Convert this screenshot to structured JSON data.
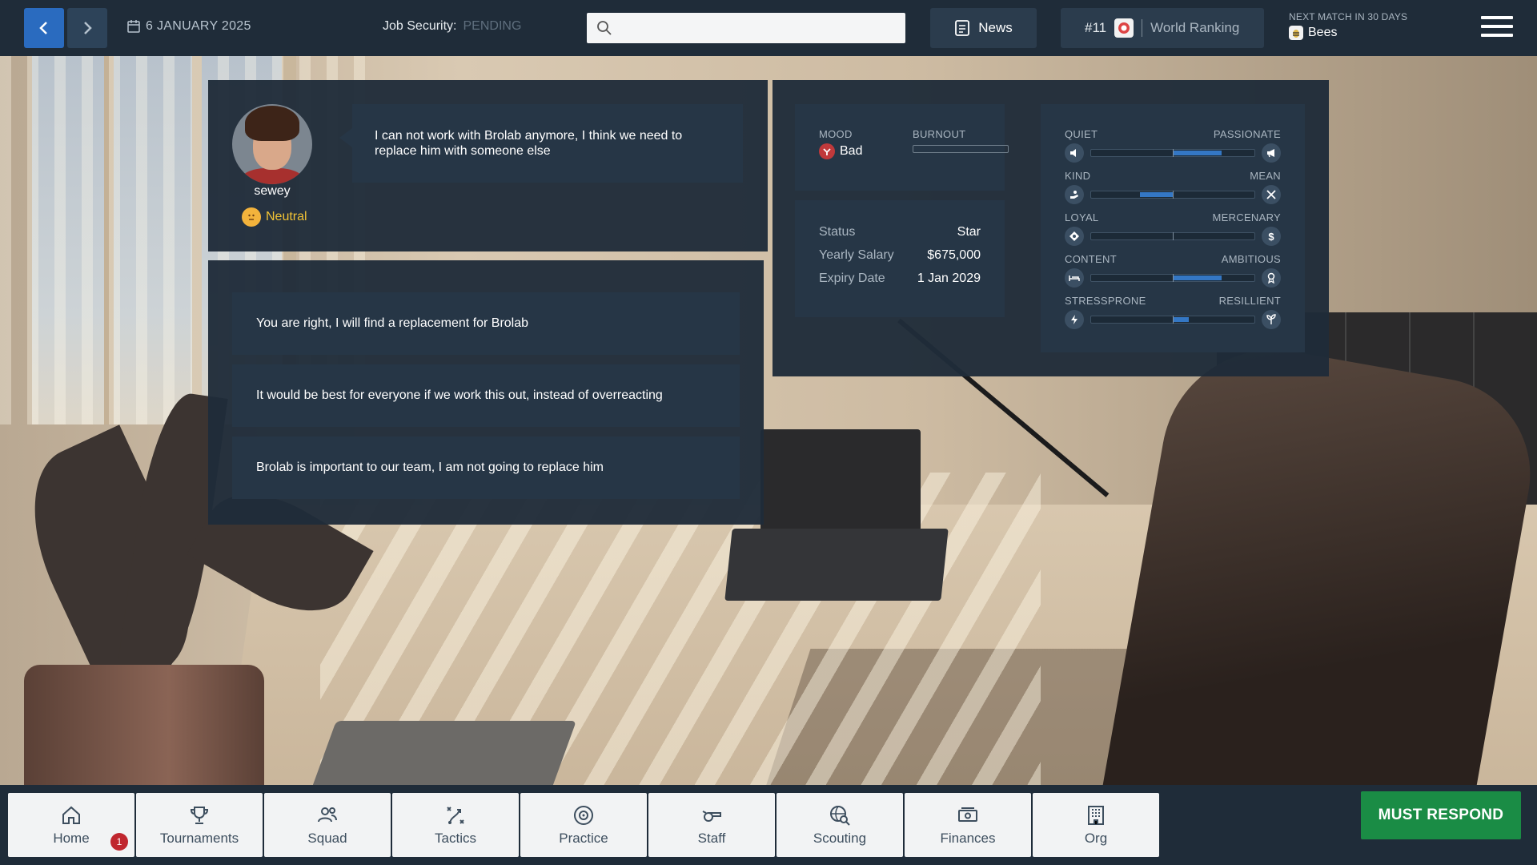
{
  "topbar": {
    "date": "6 JANUARY 2025",
    "job_security_label": "Job Security:",
    "job_security_value": "PENDING",
    "search_placeholder": "",
    "news_label": "News",
    "rank": "#11",
    "rank_label": "World Ranking",
    "next_match_label": "NEXT MATCH IN 30 DAYS",
    "next_match_team": "Bees"
  },
  "dialog": {
    "player_name": "sewey",
    "player_mood": "Neutral",
    "message": "I can not work with Brolab anymore, I think we need to replace him with someone else"
  },
  "answers": [
    "You are right, I will find a replacement for Brolab",
    "It would be best for everyone if we work this out, instead of overreacting",
    "Brolab is important to our team, I am not going to replace him"
  ],
  "stats": {
    "mood_label": "MOOD",
    "mood_value": "Bad",
    "burnout_label": "BURNOUT",
    "contract": [
      {
        "key": "Status",
        "value": "Star"
      },
      {
        "key": "Yearly Salary",
        "value": "$675,000"
      },
      {
        "key": "Expiry Date",
        "value": "1 Jan 2029"
      }
    ],
    "traits": [
      {
        "left": "QUIET",
        "right": "PASSIONATE",
        "from": 0.5,
        "to": 0.8,
        "left_icon": "speaker-mute-icon",
        "right_icon": "megaphone-icon"
      },
      {
        "left": "KIND",
        "right": "MEAN",
        "from": 0.3,
        "to": 0.5,
        "left_icon": "helping-hand-icon",
        "right_icon": "crossed-swords-icon"
      },
      {
        "left": "LOYAL",
        "right": "MERCENARY",
        "from": 0.5,
        "to": 0.5,
        "left_icon": "shield-heart-icon",
        "right_icon": "dollar-icon"
      },
      {
        "left": "CONTENT",
        "right": "AMBITIOUS",
        "from": 0.5,
        "to": 0.8,
        "left_icon": "bed-icon",
        "right_icon": "medal-icon"
      },
      {
        "left": "STRESSPRONE",
        "right": "RESILLIENT",
        "from": 0.5,
        "to": 0.6,
        "left_icon": "lightning-icon",
        "right_icon": "sprout-icon"
      }
    ]
  },
  "bottom_nav": [
    {
      "label": "Home",
      "icon": "home-icon"
    },
    {
      "label": "Tournaments",
      "icon": "trophy-icon"
    },
    {
      "label": "Squad",
      "icon": "users-icon"
    },
    {
      "label": "Tactics",
      "icon": "tactics-icon"
    },
    {
      "label": "Practice",
      "icon": "target-icon"
    },
    {
      "label": "Staff",
      "icon": "whistle-icon"
    },
    {
      "label": "Scouting",
      "icon": "globe-search-icon"
    },
    {
      "label": "Finances",
      "icon": "money-icon"
    },
    {
      "label": "Org",
      "icon": "building-icon"
    }
  ],
  "home_badge": "1",
  "must_respond": "MUST RESPOND",
  "colors": {
    "accent": "#2a6bbf",
    "panel": "#1f2c39",
    "card": "#263646",
    "respond": "#1a8c45",
    "bar_fill": "#3477c4",
    "neutral_mood": "#f2c335",
    "bad_mood": "#c0393b"
  }
}
